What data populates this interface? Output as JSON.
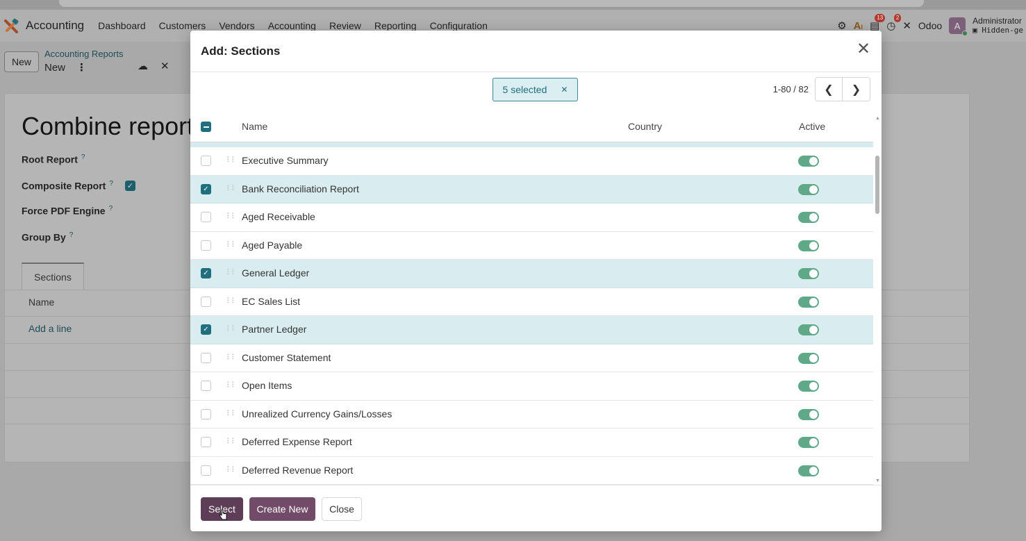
{
  "topnav": {
    "app_name": "Accounting",
    "menu": [
      "Dashboard",
      "Customers",
      "Vendors",
      "Accounting",
      "Review",
      "Reporting",
      "Configuration"
    ],
    "messages_count": "13",
    "activities_count": "2",
    "company": "Odoo",
    "avatar_letter": "A",
    "user_name": "Administrator",
    "database": "Hidden-ge"
  },
  "controlbar": {
    "new_label": "New",
    "breadcrumb_parent": "Accounting Reports",
    "breadcrumb_current": "New"
  },
  "form": {
    "title": "Combine report",
    "fields": {
      "root_report": "Root Report",
      "composite_report": "Composite Report",
      "force_pdf_engine": "Force PDF Engine",
      "group_by": "Group By"
    },
    "help_mark": "?",
    "composite_checked": true,
    "tab_sections": "Sections",
    "col_name": "Name",
    "add_line": "Add a line"
  },
  "dialog": {
    "title": "Add: Sections",
    "selected_label": "5 selected",
    "pager": "1-80 / 82",
    "columns": {
      "name": "Name",
      "country": "Country",
      "active": "Active"
    },
    "rows": [
      {
        "name": "Executive Summary",
        "selected": false,
        "active": true
      },
      {
        "name": "Bank Reconciliation Report",
        "selected": true,
        "active": true
      },
      {
        "name": "Aged Receivable",
        "selected": false,
        "active": true
      },
      {
        "name": "Aged Payable",
        "selected": false,
        "active": true
      },
      {
        "name": "General Ledger",
        "selected": true,
        "active": true
      },
      {
        "name": "EC Sales List",
        "selected": false,
        "active": true
      },
      {
        "name": "Partner Ledger",
        "selected": true,
        "active": true
      },
      {
        "name": "Customer Statement",
        "selected": false,
        "active": true
      },
      {
        "name": "Open Items",
        "selected": false,
        "active": true
      },
      {
        "name": "Unrealized Currency Gains/Losses",
        "selected": false,
        "active": true
      },
      {
        "name": "Deferred Expense Report",
        "selected": false,
        "active": true
      },
      {
        "name": "Deferred Revenue Report",
        "selected": false,
        "active": true
      }
    ],
    "buttons": {
      "select": "Select",
      "create_new": "Create New",
      "close": "Close"
    }
  },
  "colors": {
    "primary": "#714b67",
    "accent": "#1f6f7f",
    "toggle_on": "#5fa888",
    "selected_row": "#d9edf1"
  },
  "icons": [
    "accounting-app-icon",
    "bug-icon",
    "ai-icon",
    "chat-icon",
    "clock-icon",
    "tools-icon",
    "cloud-save-icon",
    "discard-icon",
    "close-icon",
    "chevron-left-icon",
    "chevron-right-icon",
    "drag-handle-icon",
    "cursor-hand-icon"
  ]
}
